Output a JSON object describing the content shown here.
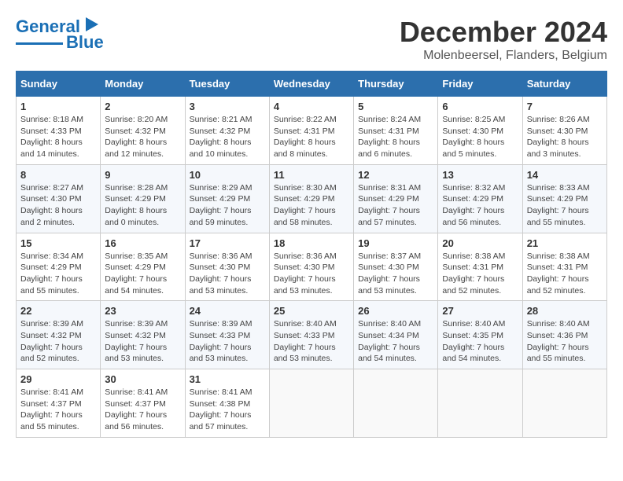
{
  "header": {
    "logo_line1": "General",
    "logo_line2": "Blue",
    "main_title": "December 2024",
    "subtitle": "Molenbeersel, Flanders, Belgium"
  },
  "calendar": {
    "headers": [
      "Sunday",
      "Monday",
      "Tuesday",
      "Wednesday",
      "Thursday",
      "Friday",
      "Saturday"
    ],
    "weeks": [
      [
        {
          "day": "1",
          "info": "Sunrise: 8:18 AM\nSunset: 4:33 PM\nDaylight: 8 hours\nand 14 minutes."
        },
        {
          "day": "2",
          "info": "Sunrise: 8:20 AM\nSunset: 4:32 PM\nDaylight: 8 hours\nand 12 minutes."
        },
        {
          "day": "3",
          "info": "Sunrise: 8:21 AM\nSunset: 4:32 PM\nDaylight: 8 hours\nand 10 minutes."
        },
        {
          "day": "4",
          "info": "Sunrise: 8:22 AM\nSunset: 4:31 PM\nDaylight: 8 hours\nand 8 minutes."
        },
        {
          "day": "5",
          "info": "Sunrise: 8:24 AM\nSunset: 4:31 PM\nDaylight: 8 hours\nand 6 minutes."
        },
        {
          "day": "6",
          "info": "Sunrise: 8:25 AM\nSunset: 4:30 PM\nDaylight: 8 hours\nand 5 minutes."
        },
        {
          "day": "7",
          "info": "Sunrise: 8:26 AM\nSunset: 4:30 PM\nDaylight: 8 hours\nand 3 minutes."
        }
      ],
      [
        {
          "day": "8",
          "info": "Sunrise: 8:27 AM\nSunset: 4:30 PM\nDaylight: 8 hours\nand 2 minutes."
        },
        {
          "day": "9",
          "info": "Sunrise: 8:28 AM\nSunset: 4:29 PM\nDaylight: 8 hours\nand 0 minutes."
        },
        {
          "day": "10",
          "info": "Sunrise: 8:29 AM\nSunset: 4:29 PM\nDaylight: 7 hours\nand 59 minutes."
        },
        {
          "day": "11",
          "info": "Sunrise: 8:30 AM\nSunset: 4:29 PM\nDaylight: 7 hours\nand 58 minutes."
        },
        {
          "day": "12",
          "info": "Sunrise: 8:31 AM\nSunset: 4:29 PM\nDaylight: 7 hours\nand 57 minutes."
        },
        {
          "day": "13",
          "info": "Sunrise: 8:32 AM\nSunset: 4:29 PM\nDaylight: 7 hours\nand 56 minutes."
        },
        {
          "day": "14",
          "info": "Sunrise: 8:33 AM\nSunset: 4:29 PM\nDaylight: 7 hours\nand 55 minutes."
        }
      ],
      [
        {
          "day": "15",
          "info": "Sunrise: 8:34 AM\nSunset: 4:29 PM\nDaylight: 7 hours\nand 55 minutes."
        },
        {
          "day": "16",
          "info": "Sunrise: 8:35 AM\nSunset: 4:29 PM\nDaylight: 7 hours\nand 54 minutes."
        },
        {
          "day": "17",
          "info": "Sunrise: 8:36 AM\nSunset: 4:30 PM\nDaylight: 7 hours\nand 53 minutes."
        },
        {
          "day": "18",
          "info": "Sunrise: 8:36 AM\nSunset: 4:30 PM\nDaylight: 7 hours\nand 53 minutes."
        },
        {
          "day": "19",
          "info": "Sunrise: 8:37 AM\nSunset: 4:30 PM\nDaylight: 7 hours\nand 53 minutes."
        },
        {
          "day": "20",
          "info": "Sunrise: 8:38 AM\nSunset: 4:31 PM\nDaylight: 7 hours\nand 52 minutes."
        },
        {
          "day": "21",
          "info": "Sunrise: 8:38 AM\nSunset: 4:31 PM\nDaylight: 7 hours\nand 52 minutes."
        }
      ],
      [
        {
          "day": "22",
          "info": "Sunrise: 8:39 AM\nSunset: 4:32 PM\nDaylight: 7 hours\nand 52 minutes."
        },
        {
          "day": "23",
          "info": "Sunrise: 8:39 AM\nSunset: 4:32 PM\nDaylight: 7 hours\nand 53 minutes."
        },
        {
          "day": "24",
          "info": "Sunrise: 8:39 AM\nSunset: 4:33 PM\nDaylight: 7 hours\nand 53 minutes."
        },
        {
          "day": "25",
          "info": "Sunrise: 8:40 AM\nSunset: 4:33 PM\nDaylight: 7 hours\nand 53 minutes."
        },
        {
          "day": "26",
          "info": "Sunrise: 8:40 AM\nSunset: 4:34 PM\nDaylight: 7 hours\nand 54 minutes."
        },
        {
          "day": "27",
          "info": "Sunrise: 8:40 AM\nSunset: 4:35 PM\nDaylight: 7 hours\nand 54 minutes."
        },
        {
          "day": "28",
          "info": "Sunrise: 8:40 AM\nSunset: 4:36 PM\nDaylight: 7 hours\nand 55 minutes."
        }
      ],
      [
        {
          "day": "29",
          "info": "Sunrise: 8:41 AM\nSunset: 4:37 PM\nDaylight: 7 hours\nand 55 minutes."
        },
        {
          "day": "30",
          "info": "Sunrise: 8:41 AM\nSunset: 4:37 PM\nDaylight: 7 hours\nand 56 minutes."
        },
        {
          "day": "31",
          "info": "Sunrise: 8:41 AM\nSunset: 4:38 PM\nDaylight: 7 hours\nand 57 minutes."
        },
        {
          "day": "",
          "info": ""
        },
        {
          "day": "",
          "info": ""
        },
        {
          "day": "",
          "info": ""
        },
        {
          "day": "",
          "info": ""
        }
      ]
    ]
  }
}
